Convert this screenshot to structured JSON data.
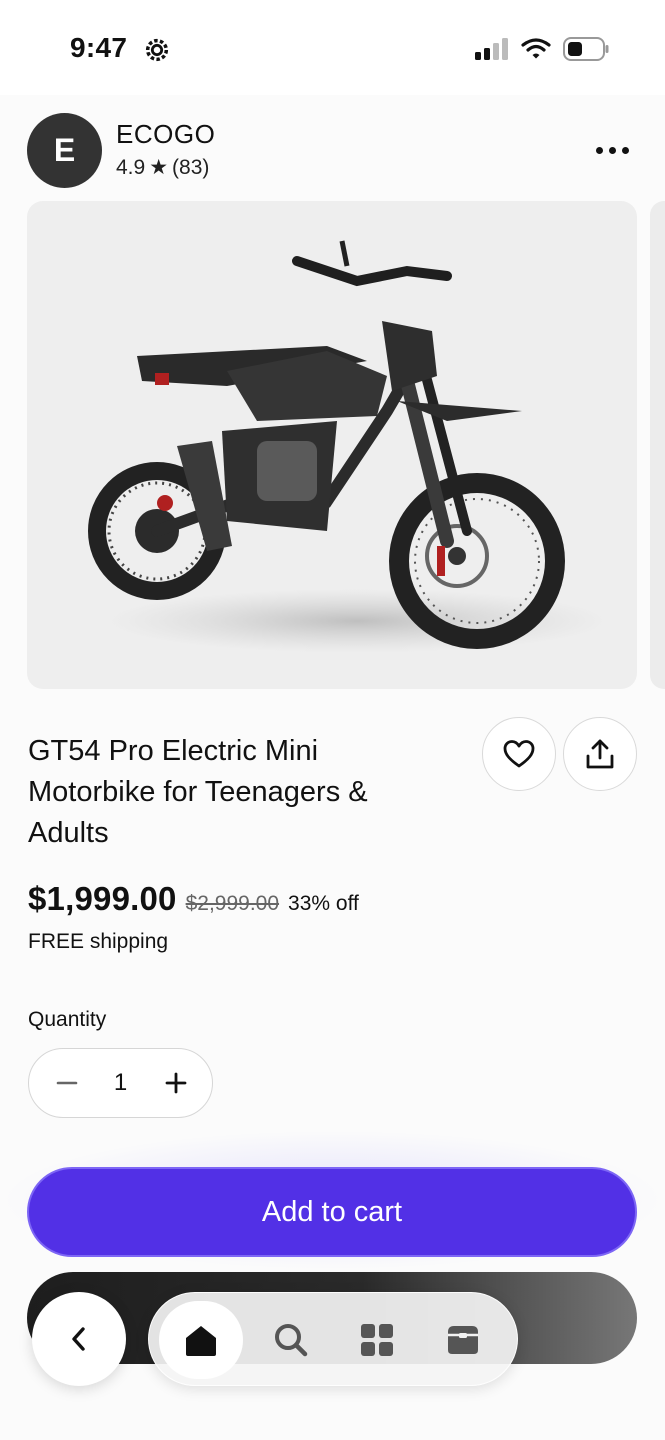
{
  "status_bar": {
    "time": "9:47"
  },
  "seller": {
    "avatar_letter": "E",
    "name": "ECOGO",
    "rating": "4.9",
    "star": "★",
    "review_count": "(83)"
  },
  "product": {
    "title": "GT54 Pro Electric Mini Motorbike for Teenagers & Adults",
    "price": "$1,999.00",
    "original_price": "$2,999.00",
    "discount": "33% off",
    "shipping": "FREE shipping"
  },
  "quantity": {
    "label": "Quantity",
    "value": "1"
  },
  "actions": {
    "add_to_cart": "Add to cart"
  },
  "colors": {
    "accent": "#5230e6",
    "text": "#111111",
    "background": "#fbfbfb"
  },
  "icons": {
    "status": [
      "gear-icon",
      "cellular-signal-icon",
      "wifi-icon",
      "battery-icon"
    ],
    "header": [
      "more-icon"
    ],
    "product": [
      "heart-icon",
      "share-icon"
    ],
    "stepper": [
      "minus-icon",
      "plus-icon"
    ],
    "nav": [
      "back-icon",
      "home-icon",
      "search-icon",
      "categories-icon",
      "orders-icon"
    ]
  }
}
